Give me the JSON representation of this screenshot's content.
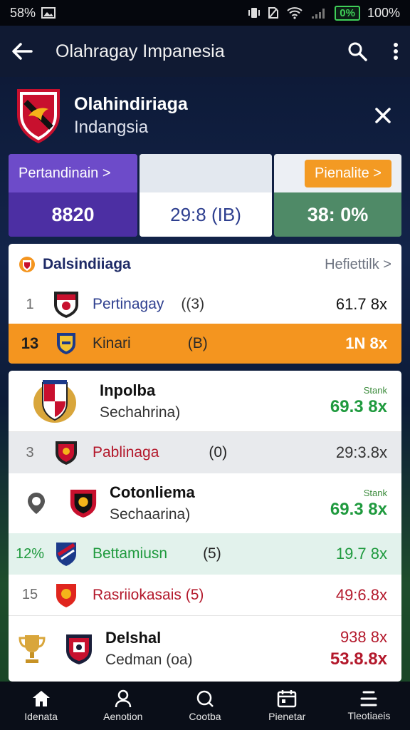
{
  "status_bar": {
    "left_text": "58%",
    "battery_percent": "0%",
    "right_text": "100%"
  },
  "app_bar": {
    "title": "Olahragay Impanesia",
    "back_icon": "back-arrow-icon",
    "search_icon": "search-icon",
    "menu_icon": "more-vert-icon"
  },
  "league": {
    "name": "Olahindiriaga",
    "subtitle": "Indangsia",
    "close_icon": "close-icon"
  },
  "stat_tiles": [
    {
      "label": "Pertandinain >",
      "value": "8820"
    },
    {
      "label": "",
      "value": "29:8 (IB)"
    },
    {
      "label": "Pienalite >",
      "value": "38: 0%"
    }
  ],
  "panel1": {
    "title": "Dalsindiiaga",
    "link": "Hefiettilk >",
    "rows": [
      {
        "rank": "1",
        "team": "Pertinagay",
        "extra": "((3)",
        "value": "61.7 8x"
      },
      {
        "rank": "13",
        "team": "Kinari",
        "extra": "(B)",
        "value": "1N 8x"
      }
    ]
  },
  "panel2": {
    "rows": [
      {
        "team": "Inpolba",
        "sub": "Sechahrina)",
        "small": "Stank",
        "value": "69.3 8x"
      },
      {
        "rank": "3",
        "team": "Pablinaga",
        "extra": "(0)",
        "value": "29:3.8x"
      },
      {
        "team": "Cotonliema",
        "sub": "Sechaarina)",
        "small": "Stank",
        "value": "69.3 8x"
      },
      {
        "rank": "12%",
        "team": "Bettamiusn",
        "extra": "(5)",
        "value": "19.7 8x"
      },
      {
        "rank": "15",
        "team": "Rasriiokasais (5)",
        "value": "49:6.8x"
      },
      {
        "team": "Delshal",
        "sub": "Cedman (oa)",
        "value_top": "938 8x",
        "value": "53.8.8x"
      }
    ]
  },
  "bottom_nav": [
    {
      "label": "Idenata",
      "icon": "home-icon"
    },
    {
      "label": "Aenotion",
      "icon": "person-icon"
    },
    {
      "label": "Cootba",
      "icon": "search-icon"
    },
    {
      "label": "Pienetar",
      "icon": "calendar-icon"
    },
    {
      "label": "Tleotiaeis",
      "icon": "list-icon"
    }
  ],
  "colors": {
    "accent_purple": "#5b3bb8",
    "accent_orange": "#f4951f",
    "accent_green": "#4f8a67",
    "positive": "#1f9a3e",
    "negative": "#b3182b"
  }
}
